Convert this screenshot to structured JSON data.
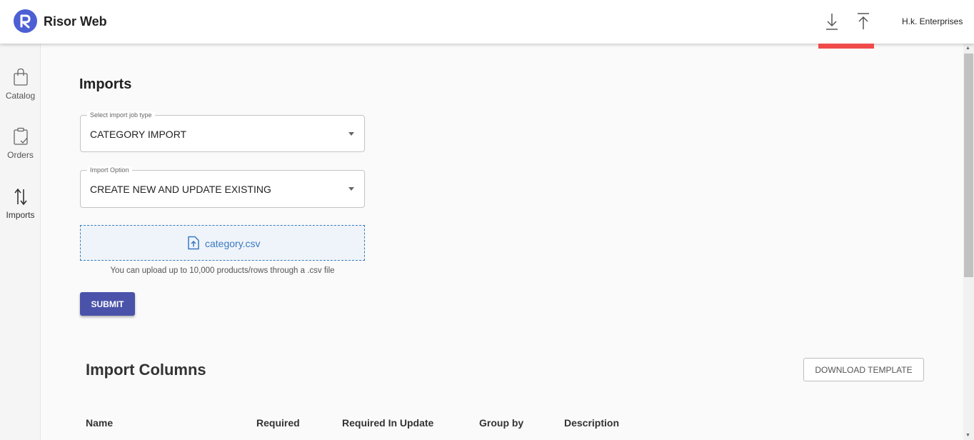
{
  "header": {
    "app_title": "Risor Web",
    "logo_icon": "risor-logo-icon",
    "download_icon": "download-arrow-icon",
    "upload_icon": "upload-arrow-icon",
    "company_name": "H.k. Enterprises",
    "accent_color": "#4c5fd3",
    "indicator_color": "#f04b4b"
  },
  "sidebar": {
    "items": [
      {
        "label": "Catalog",
        "icon": "shopping-bag-icon",
        "active": false
      },
      {
        "label": "Orders",
        "icon": "clipboard-check-icon",
        "active": false
      },
      {
        "label": "Imports",
        "icon": "swap-vertical-icon",
        "active": true
      }
    ]
  },
  "main": {
    "title": "Imports",
    "job_type": {
      "legend": "Select import job type",
      "value": "CATEGORY IMPORT"
    },
    "import_option": {
      "legend": "Import Option",
      "value": "CREATE NEW AND UPDATE EXISTING"
    },
    "upload": {
      "file_icon": "file-upload-icon",
      "file_name": "category.csv",
      "hint": "You can upload up to 10,000 products/rows through a .csv file"
    },
    "submit_label": "SUBMIT",
    "submit_color": "#4a52a9"
  },
  "columns_section": {
    "title": "Import Columns",
    "download_template_label": "DOWNLOAD TEMPLATE",
    "headers": [
      "Name",
      "Required",
      "Required In Update",
      "Group by",
      "Description"
    ]
  }
}
